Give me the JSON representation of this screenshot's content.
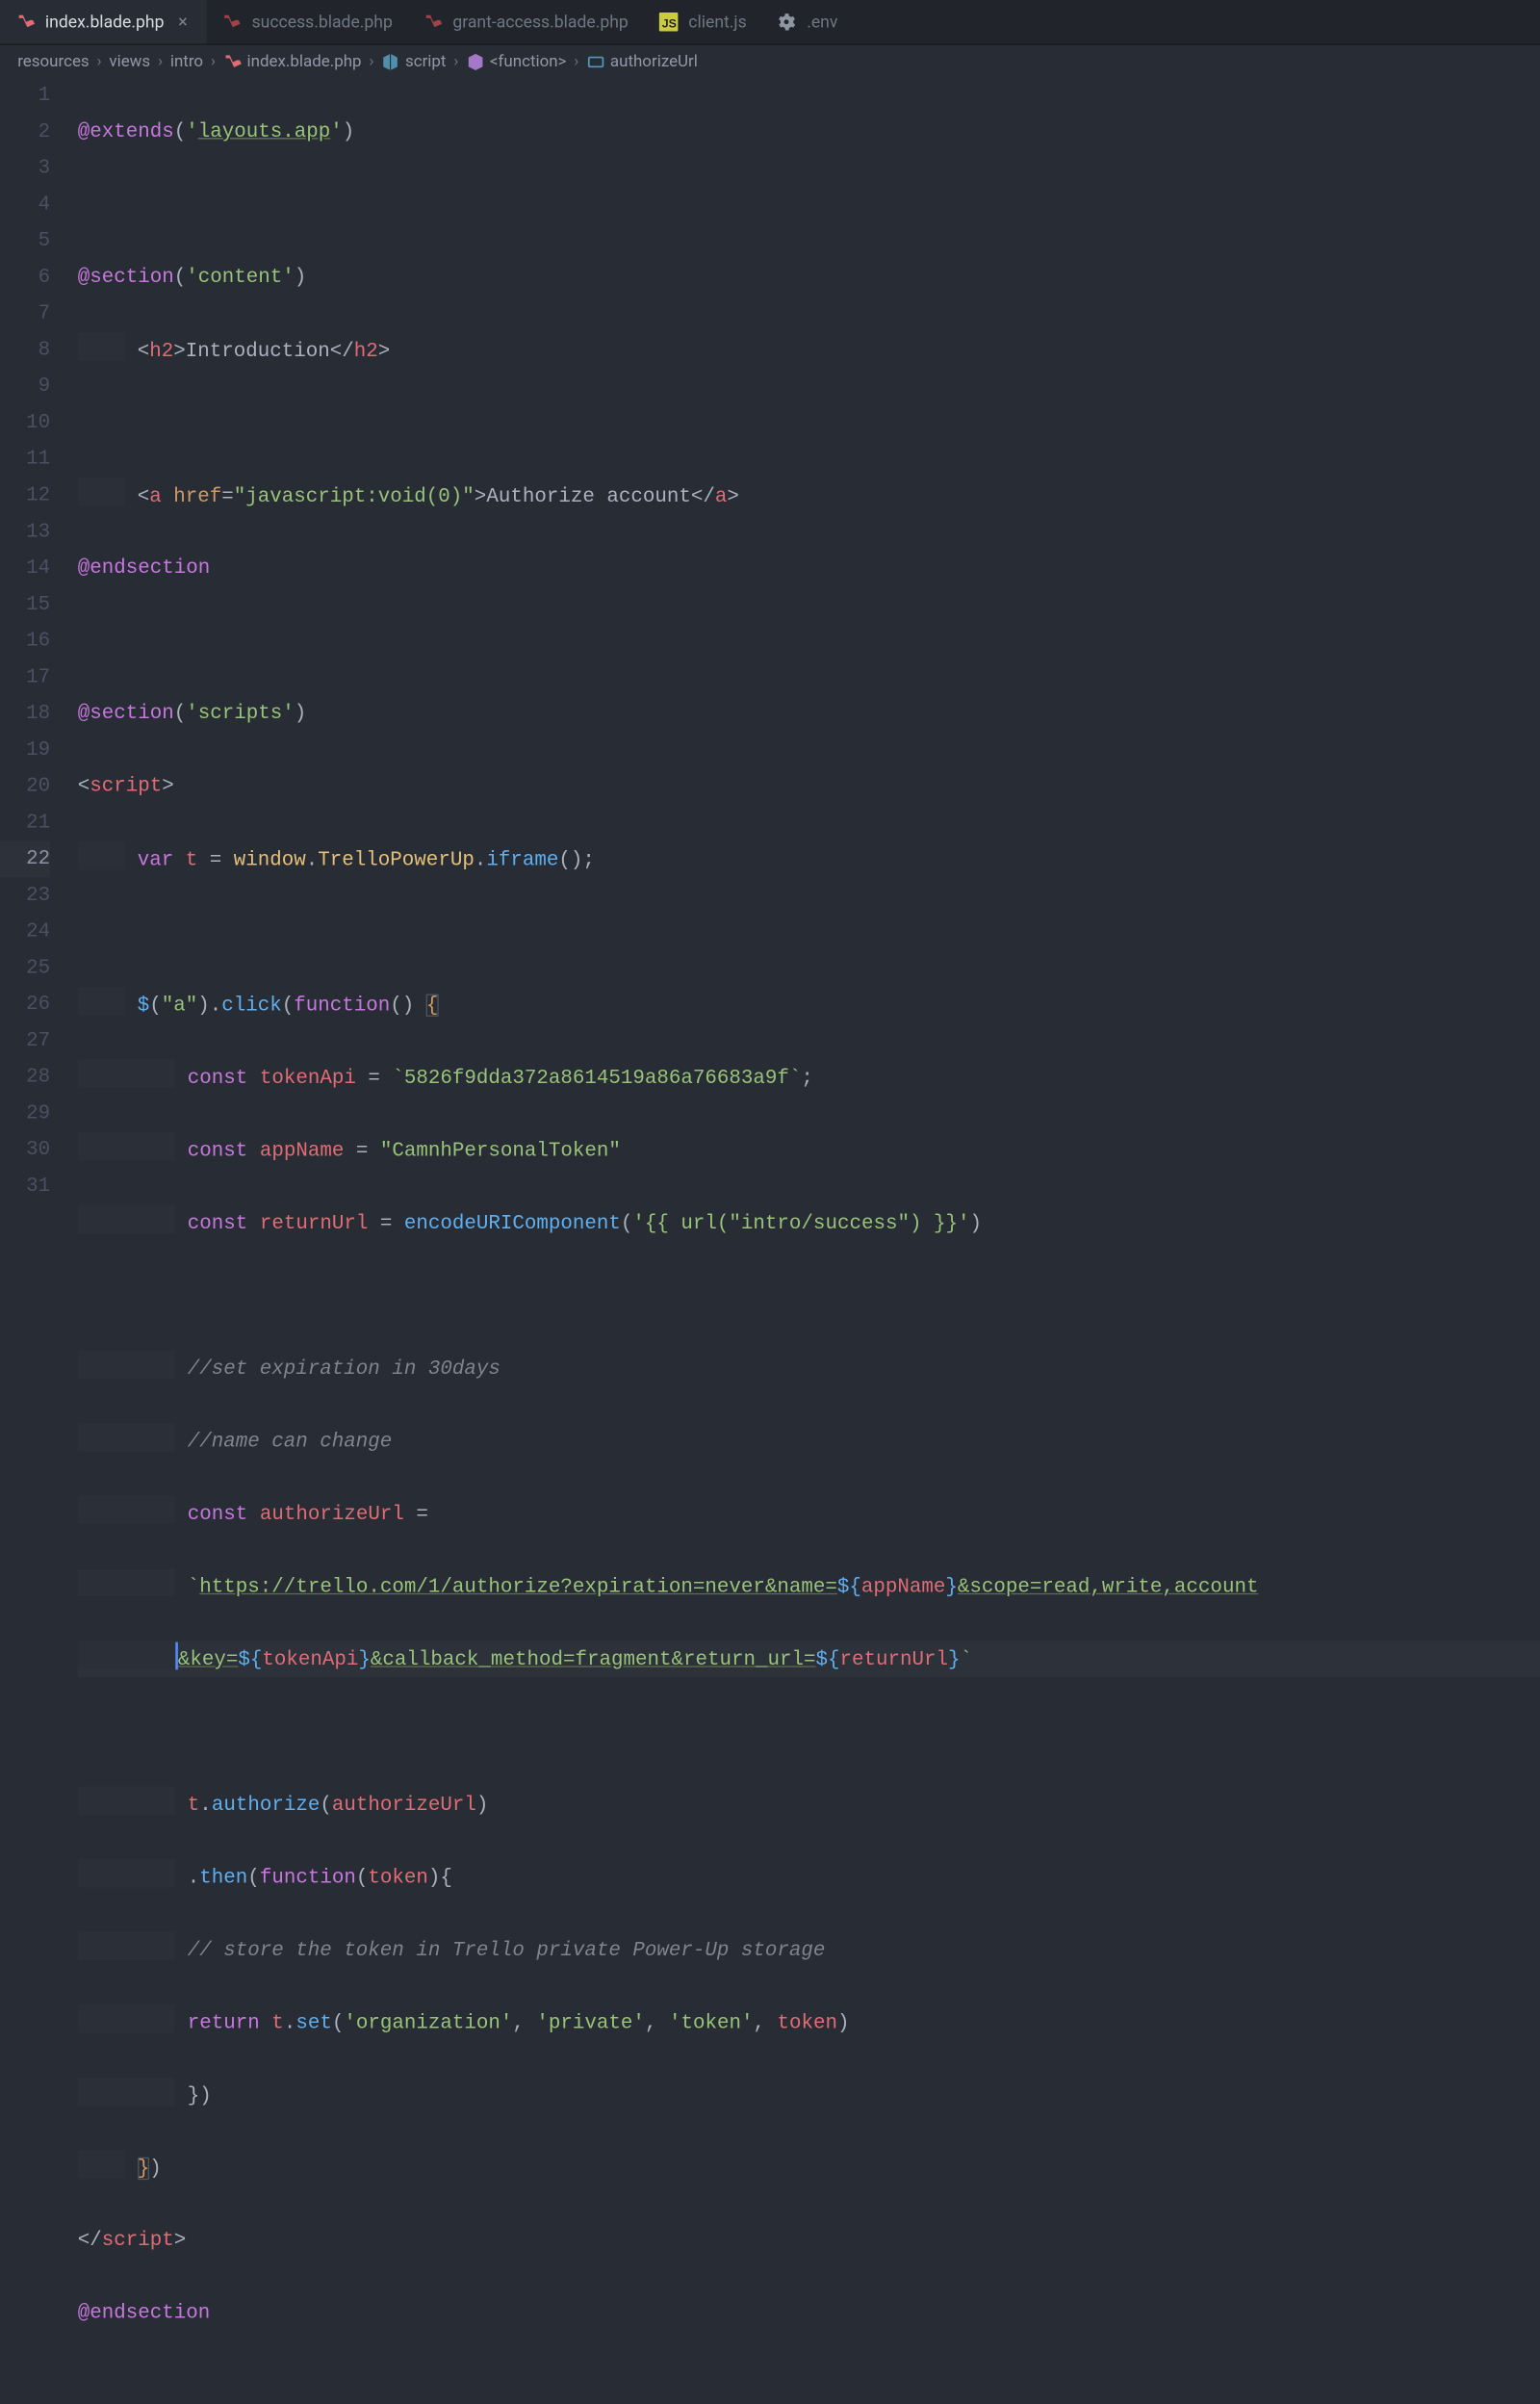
{
  "tabs": [
    {
      "name": "index.blade.php",
      "icon": "laravel",
      "active": true,
      "closable": true
    },
    {
      "name": "success.blade.php",
      "icon": "laravel",
      "active": false,
      "closable": false
    },
    {
      "name": "grant-access.blade.php",
      "icon": "laravel",
      "active": false,
      "closable": false
    },
    {
      "name": "client.js",
      "icon": "js",
      "active": false,
      "closable": false
    },
    {
      "name": ".env",
      "icon": "gear",
      "active": false,
      "closable": false
    }
  ],
  "breadcrumbs": [
    {
      "label": "resources",
      "icon": null
    },
    {
      "label": "views",
      "icon": null
    },
    {
      "label": "intro",
      "icon": null
    },
    {
      "label": "index.blade.php",
      "icon": "laravel"
    },
    {
      "label": "script",
      "icon": "cube-blue"
    },
    {
      "label": "<function>",
      "icon": "cube-purple"
    },
    {
      "label": "authorizeUrl",
      "icon": "brackets"
    }
  ],
  "line_numbers": [
    "1",
    "2",
    "3",
    "4",
    "5",
    "6",
    "7",
    "8",
    "9",
    "10",
    "11",
    "12",
    "13",
    "14",
    "15",
    "16",
    "17",
    "18",
    "19",
    "20",
    "21",
    "22",
    "23",
    "24",
    "25",
    "26",
    "27",
    "28",
    "29",
    "30",
    "31"
  ],
  "active_line": 22,
  "code": {
    "l1": {
      "kw": "@extends",
      "str": "layouts.app"
    },
    "l3": {
      "kw": "@section",
      "str": "content"
    },
    "l4": {
      "tag": "h2",
      "text": "Introduction"
    },
    "l6": {
      "tag": "a",
      "attr": "href",
      "href": "javascript:void(0)",
      "text": "Authorize account"
    },
    "l7": {
      "kw": "@endsection"
    },
    "l9": {
      "kw": "@section",
      "str": "scripts"
    },
    "l10": {
      "tag": "script"
    },
    "l11": {
      "kw": "var",
      "v": "t",
      "o1": "window",
      "o2": "TrelloPowerUp",
      "m": "iframe"
    },
    "l13": {
      "sel": "a",
      "m1": "click",
      "kw": "function"
    },
    "l14": {
      "kw": "const",
      "v": "tokenApi",
      "val": "5826f9dda372a8614519a86a76683a9f"
    },
    "l15": {
      "kw": "const",
      "v": "appName",
      "val": "CamnhPersonalToken"
    },
    "l16": {
      "kw": "const",
      "v": "returnUrl",
      "fn": "encodeURIComponent",
      "arg": "{{ url(\"intro/success\") }}"
    },
    "l18": {
      "cmt": "//set expiration in 30days"
    },
    "l19": {
      "cmt": "//name can change"
    },
    "l20": {
      "kw": "const",
      "v": "authorizeUrl"
    },
    "l21": {
      "url_a": "https://trello.com/1/authorize?expiration=never&name=",
      "v1": "appName",
      "url_b": "&scope=read,write,account"
    },
    "l22": {
      "url_a": "&key=",
      "v1": "tokenApi",
      "url_b": "&callback_method=fragment&return_url=",
      "v2": "returnUrl"
    },
    "l24": {
      "o": "t",
      "m": "authorize",
      "arg": "authorizeUrl"
    },
    "l25": {
      "m": "then",
      "kw": "function",
      "p": "token"
    },
    "l26": {
      "cmt": "// store the token in Trello private Power-Up storage"
    },
    "l27": {
      "kw": "return",
      "o": "t",
      "m": "set",
      "a1": "organization",
      "a2": "private",
      "a3": "token",
      "a4": "token"
    },
    "l30": {
      "tag": "script"
    },
    "l31": {
      "kw": "@endsection"
    }
  }
}
